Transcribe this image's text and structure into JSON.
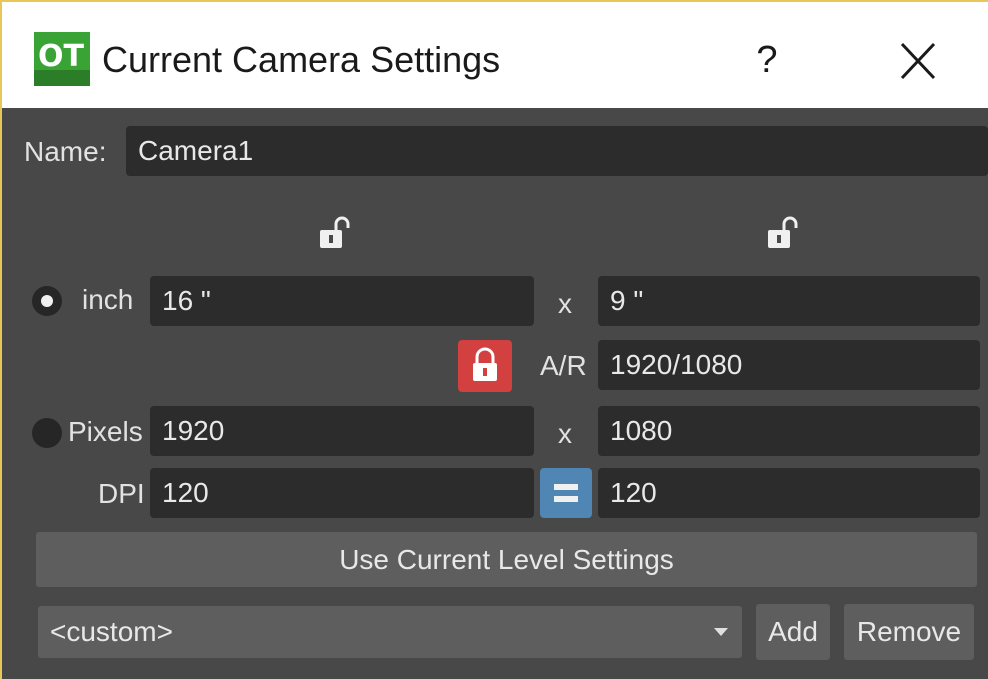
{
  "window": {
    "title": "Current Camera Settings",
    "help_label": "?",
    "app_icon": "opentoonz-logo-icon",
    "close_icon": "close-icon"
  },
  "name_row": {
    "label": "Name:",
    "value": "Camera1"
  },
  "size_units": {
    "unit_label": "inch",
    "selected": true,
    "width_value": "16 \"",
    "height_value": "9 \"",
    "separator": "x",
    "width_lock_icon": "lock-open-icon",
    "height_lock_icon": "lock-open-icon"
  },
  "aspect_ratio": {
    "label": "A/R",
    "value": "1920/1080",
    "lock_icon": "lock-closed-icon",
    "lock_color": "#d24040"
  },
  "pixels": {
    "label": "Pixels",
    "selected": false,
    "width_value": "1920",
    "height_value": "1080",
    "separator": "x"
  },
  "dpi": {
    "label": "DPI",
    "x_value": "120",
    "y_value": "120",
    "link_icon": "equal-link-icon",
    "link_color": "#4f86b3"
  },
  "use_current_level_button": "Use Current Level Settings",
  "preset": {
    "selected": "<custom>",
    "add_label": "Add",
    "remove_label": "Remove"
  },
  "colors": {
    "window_bg": "#484848",
    "field_bg": "#2c2c2c",
    "button_bg": "#5e5e5e",
    "title_border": "#e8c65a"
  }
}
